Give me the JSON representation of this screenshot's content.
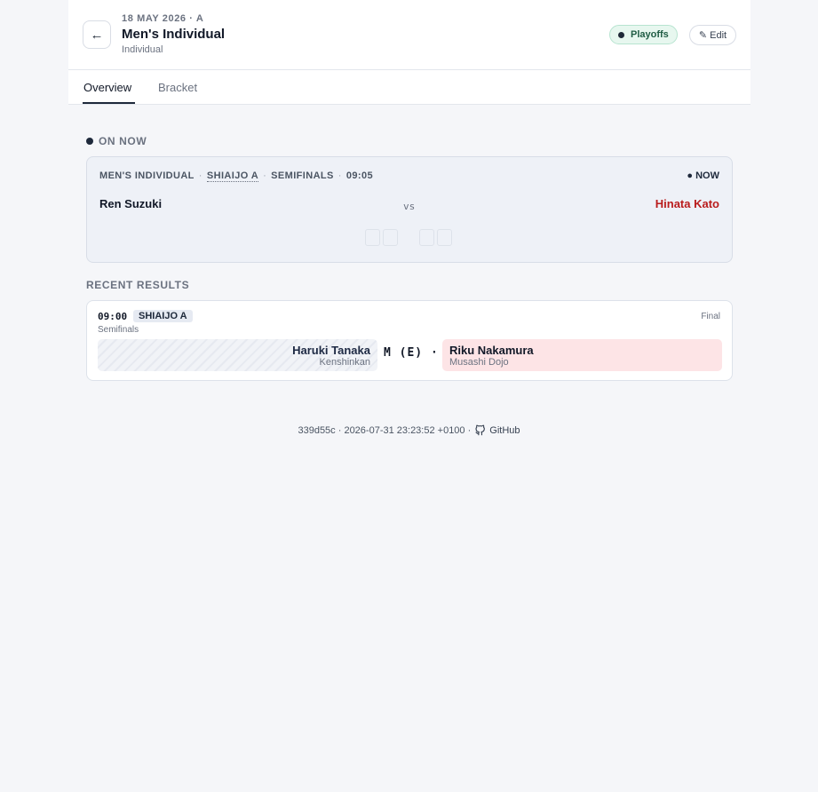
{
  "header": {
    "back_label": "←",
    "meta": "18 MAY 2026 · A",
    "title": "Men's Individual",
    "subtitle": "Individual",
    "phase_badge": "Playoffs",
    "edit_label": "✎ Edit"
  },
  "tabs": [
    {
      "label": "Overview",
      "active": true
    },
    {
      "label": "Bracket",
      "active": false
    }
  ],
  "on_now": {
    "section_label": "ON NOW",
    "meta": {
      "event": "MEN'S INDIVIDUAL",
      "court": "SHIAIJO A",
      "round": "SEMIFINALS",
      "time": "09:05",
      "separator": "·"
    },
    "flag": "● NOW",
    "left_player": "Ren Suzuki",
    "vs": "vs",
    "right_player": "Hinata Kato"
  },
  "recent_results": {
    "section_label": "RECENT RESULTS",
    "items": [
      {
        "time": "09:00",
        "court": "SHIAIJO A",
        "round": "Semifinals",
        "status": "Final",
        "left": {
          "name": "Haruki Tanaka",
          "dojo": "Kenshinkan"
        },
        "score": "M (E) ·",
        "right": {
          "name": "Riku Nakamura",
          "dojo": "Musashi Dojo"
        }
      }
    ]
  },
  "footer": {
    "build": "339d55c · 2026-07-31 23:23:52 +0100 ·",
    "github_label": "GitHub"
  },
  "colors": {
    "accent": "#1e293b",
    "playoffs_bg": "#e7f7ef",
    "red_player": "#b91c1c",
    "red_box": "#fde4e6"
  }
}
